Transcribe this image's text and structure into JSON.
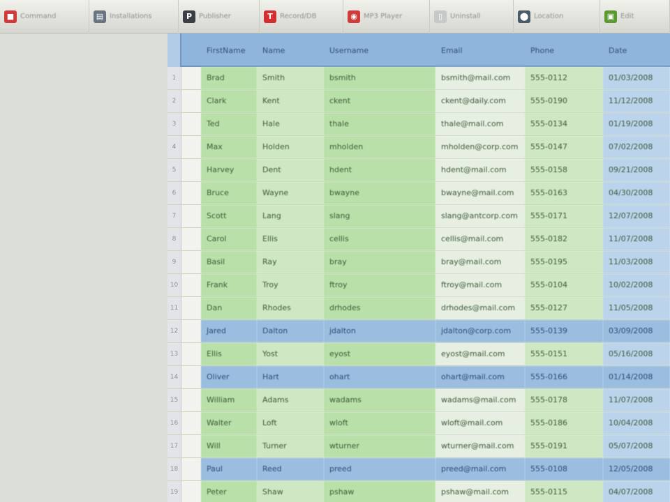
{
  "toolbar": {
    "items": [
      {
        "label": "Command",
        "icon": "red-square-icon",
        "color": "#d13a3a"
      },
      {
        "label": "Installations",
        "icon": "printer-icon",
        "color": "#6a7480"
      },
      {
        "label": "Publisher",
        "icon": "p-logo-icon",
        "color": "#3b3f45"
      },
      {
        "label": "Record/DB",
        "icon": "red-logo-icon",
        "color": "#d23030"
      },
      {
        "label": "MP3 Player",
        "icon": "record-icon",
        "color": "#d03c3c"
      },
      {
        "label": "Uninstall",
        "icon": "vial-icon",
        "color": "#c7c9c9"
      },
      {
        "label": "Location",
        "icon": "pin-icon",
        "color": "#4a5a66"
      },
      {
        "label": "Edit",
        "icon": "green-badge-icon",
        "color": "#5a9a2e"
      }
    ]
  },
  "grid": {
    "columns": [
      "FirstName",
      "Name",
      "Username",
      "Email",
      "Phone",
      "Date"
    ],
    "rows": [
      {
        "n": "1",
        "cells": [
          "Brad",
          "Smith",
          "bsmith",
          "bsmith@mail.com",
          "555-0112",
          "01/03/2008"
        ]
      },
      {
        "n": "2",
        "cells": [
          "Clark",
          "Kent",
          "ckent",
          "ckent@daily.com",
          "555-0190",
          "11/12/2008"
        ]
      },
      {
        "n": "3",
        "cells": [
          "Ted",
          "Hale",
          "thale",
          "thale@mail.com",
          "555-0134",
          "01/19/2008"
        ]
      },
      {
        "n": "4",
        "cells": [
          "Max",
          "Holden",
          "mholden",
          "mholden@corp.com",
          "555-0147",
          "07/02/2008"
        ]
      },
      {
        "n": "5",
        "cells": [
          "Harvey",
          "Dent",
          "hdent",
          "hdent@mail.com",
          "555-0158",
          "09/21/2008"
        ]
      },
      {
        "n": "6",
        "cells": [
          "Bruce",
          "Wayne",
          "bwayne",
          "bwayne@mail.com",
          "555-0163",
          "04/30/2008"
        ]
      },
      {
        "n": "7",
        "cells": [
          "Scott",
          "Lang",
          "slang",
          "slang@antcorp.com",
          "555-0171",
          "12/07/2008"
        ]
      },
      {
        "n": "8",
        "cells": [
          "Carol",
          "Ellis",
          "cellis",
          "cellis@mail.com",
          "555-0182",
          "11/07/2008"
        ]
      },
      {
        "n": "9",
        "cells": [
          "Basil",
          "Ray",
          "bray",
          "bray@mail.com",
          "555-0195",
          "11/03/2008"
        ]
      },
      {
        "n": "10",
        "cells": [
          "Frank",
          "Troy",
          "ftroy",
          "ftroy@mail.com",
          "555-0104",
          "10/02/2008"
        ]
      },
      {
        "n": "11",
        "cells": [
          "Dan",
          "Rhodes",
          "drhodes",
          "drhodes@mail.com",
          "555-0127",
          "11/05/2008"
        ]
      },
      {
        "n": "12",
        "cells": [
          "Jared",
          "Dalton",
          "jdalton",
          "jdalton@corp.com",
          "555-0139",
          "03/09/2008"
        ]
      },
      {
        "n": "13",
        "cells": [
          "Ellis",
          "Yost",
          "eyost",
          "eyost@mail.com",
          "555-0151",
          "05/16/2008"
        ]
      },
      {
        "n": "14",
        "cells": [
          "Oliver",
          "Hart",
          "ohart",
          "ohart@mail.com",
          "555-0166",
          "01/14/2008"
        ]
      },
      {
        "n": "15",
        "cells": [
          "William",
          "Adams",
          "wadams",
          "wadams@mail.com",
          "555-0178",
          "11/07/2008"
        ]
      },
      {
        "n": "16",
        "cells": [
          "Walter",
          "Loft",
          "wloft",
          "wloft@mail.com",
          "555-0186",
          "10/04/2008"
        ]
      },
      {
        "n": "17",
        "cells": [
          "Will",
          "Turner",
          "wturner",
          "wturner@mail.com",
          "555-0191",
          "05/07/2008"
        ]
      },
      {
        "n": "18",
        "cells": [
          "Paul",
          "Reed",
          "preed",
          "preed@mail.com",
          "555-0108",
          "12/05/2008"
        ]
      },
      {
        "n": "19",
        "cells": [
          "Peter",
          "Shaw",
          "pshaw",
          "pshaw@mail.com",
          "555-0115",
          "04/07/2008"
        ]
      }
    ],
    "selected_rows": [
      11,
      13,
      17
    ]
  }
}
